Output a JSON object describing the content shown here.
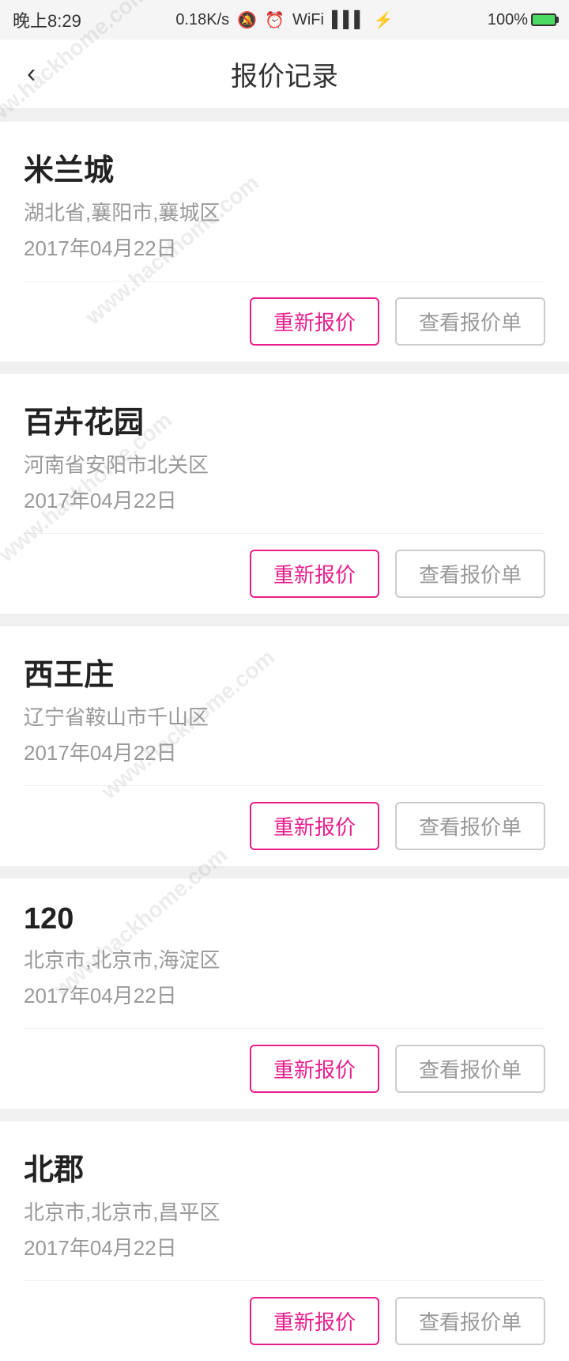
{
  "statusBar": {
    "time": "晚上8:29",
    "network": "0.18K/s",
    "battery": "100%"
  },
  "navBar": {
    "backLabel": "‹",
    "title": "报价记录"
  },
  "items": [
    {
      "name": "米兰城",
      "address": "湖北省,襄阳市,襄城区",
      "date": "2017年04月22日",
      "btnRequote": "重新报价",
      "btnViewQuote": "查看报价单"
    },
    {
      "name": "百卉花园",
      "address": "河南省安阳市北关区",
      "date": "2017年04月22日",
      "btnRequote": "重新报价",
      "btnViewQuote": "查看报价单"
    },
    {
      "name": "西王庄",
      "address": "辽宁省鞍山市千山区",
      "date": "2017年04月22日",
      "btnRequote": "重新报价",
      "btnViewQuote": "查看报价单"
    },
    {
      "name": "120",
      "address": "北京市,北京市,海淀区",
      "date": "2017年04月22日",
      "btnRequote": "重新报价",
      "btnViewQuote": "查看报价单"
    },
    {
      "name": "北郡",
      "address": "北京市,北京市,昌平区",
      "date": "2017年04月22日",
      "btnRequote": "重新报价",
      "btnViewQuote": "查看报价单"
    }
  ]
}
